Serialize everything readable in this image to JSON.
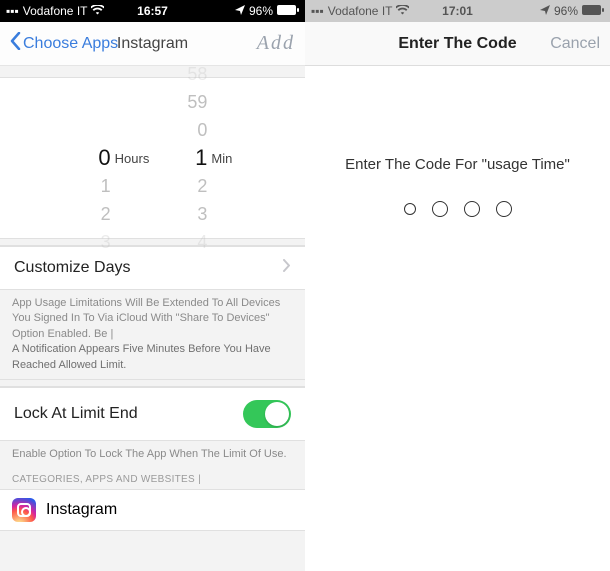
{
  "left": {
    "status": {
      "carrier": "Vodafone IT",
      "time": "16:57",
      "battery": "96%"
    },
    "nav": {
      "back": "Choose Apps",
      "title": "Instagram",
      "action": "Add"
    },
    "picker": {
      "hours": {
        "above": [],
        "selected": "0",
        "below": [
          "1",
          "2",
          "3"
        ],
        "unit": "Hours"
      },
      "minutes": {
        "above": [
          "58",
          "59",
          "0"
        ],
        "selected": "1",
        "below": [
          "2",
          "3",
          "4"
        ],
        "unit": "Min"
      }
    },
    "customize_row": "Customize Days",
    "note1": "App Usage Limitations Will Be Extended To All Devices You Signed In To Via iCloud With \"Share To Devices\" Option Enabled.",
    "note2": "A Notification Appears Five Minutes Before You Have Reached Allowed Limit.",
    "lock_row": "Lock At Limit End",
    "lock_note": "Enable Option To Lock The App When The Limit Of Use.",
    "section_label": "CATEGORIES, APPS AND WEBSITES",
    "app_name": "Instagram"
  },
  "right": {
    "status": {
      "carrier": "Vodafone IT",
      "time": "17:01",
      "battery": "96%"
    },
    "nav": {
      "title": "Enter The Code",
      "cancel": "Cancel"
    },
    "prompt": "Enter The Code For \"usage Time\""
  }
}
